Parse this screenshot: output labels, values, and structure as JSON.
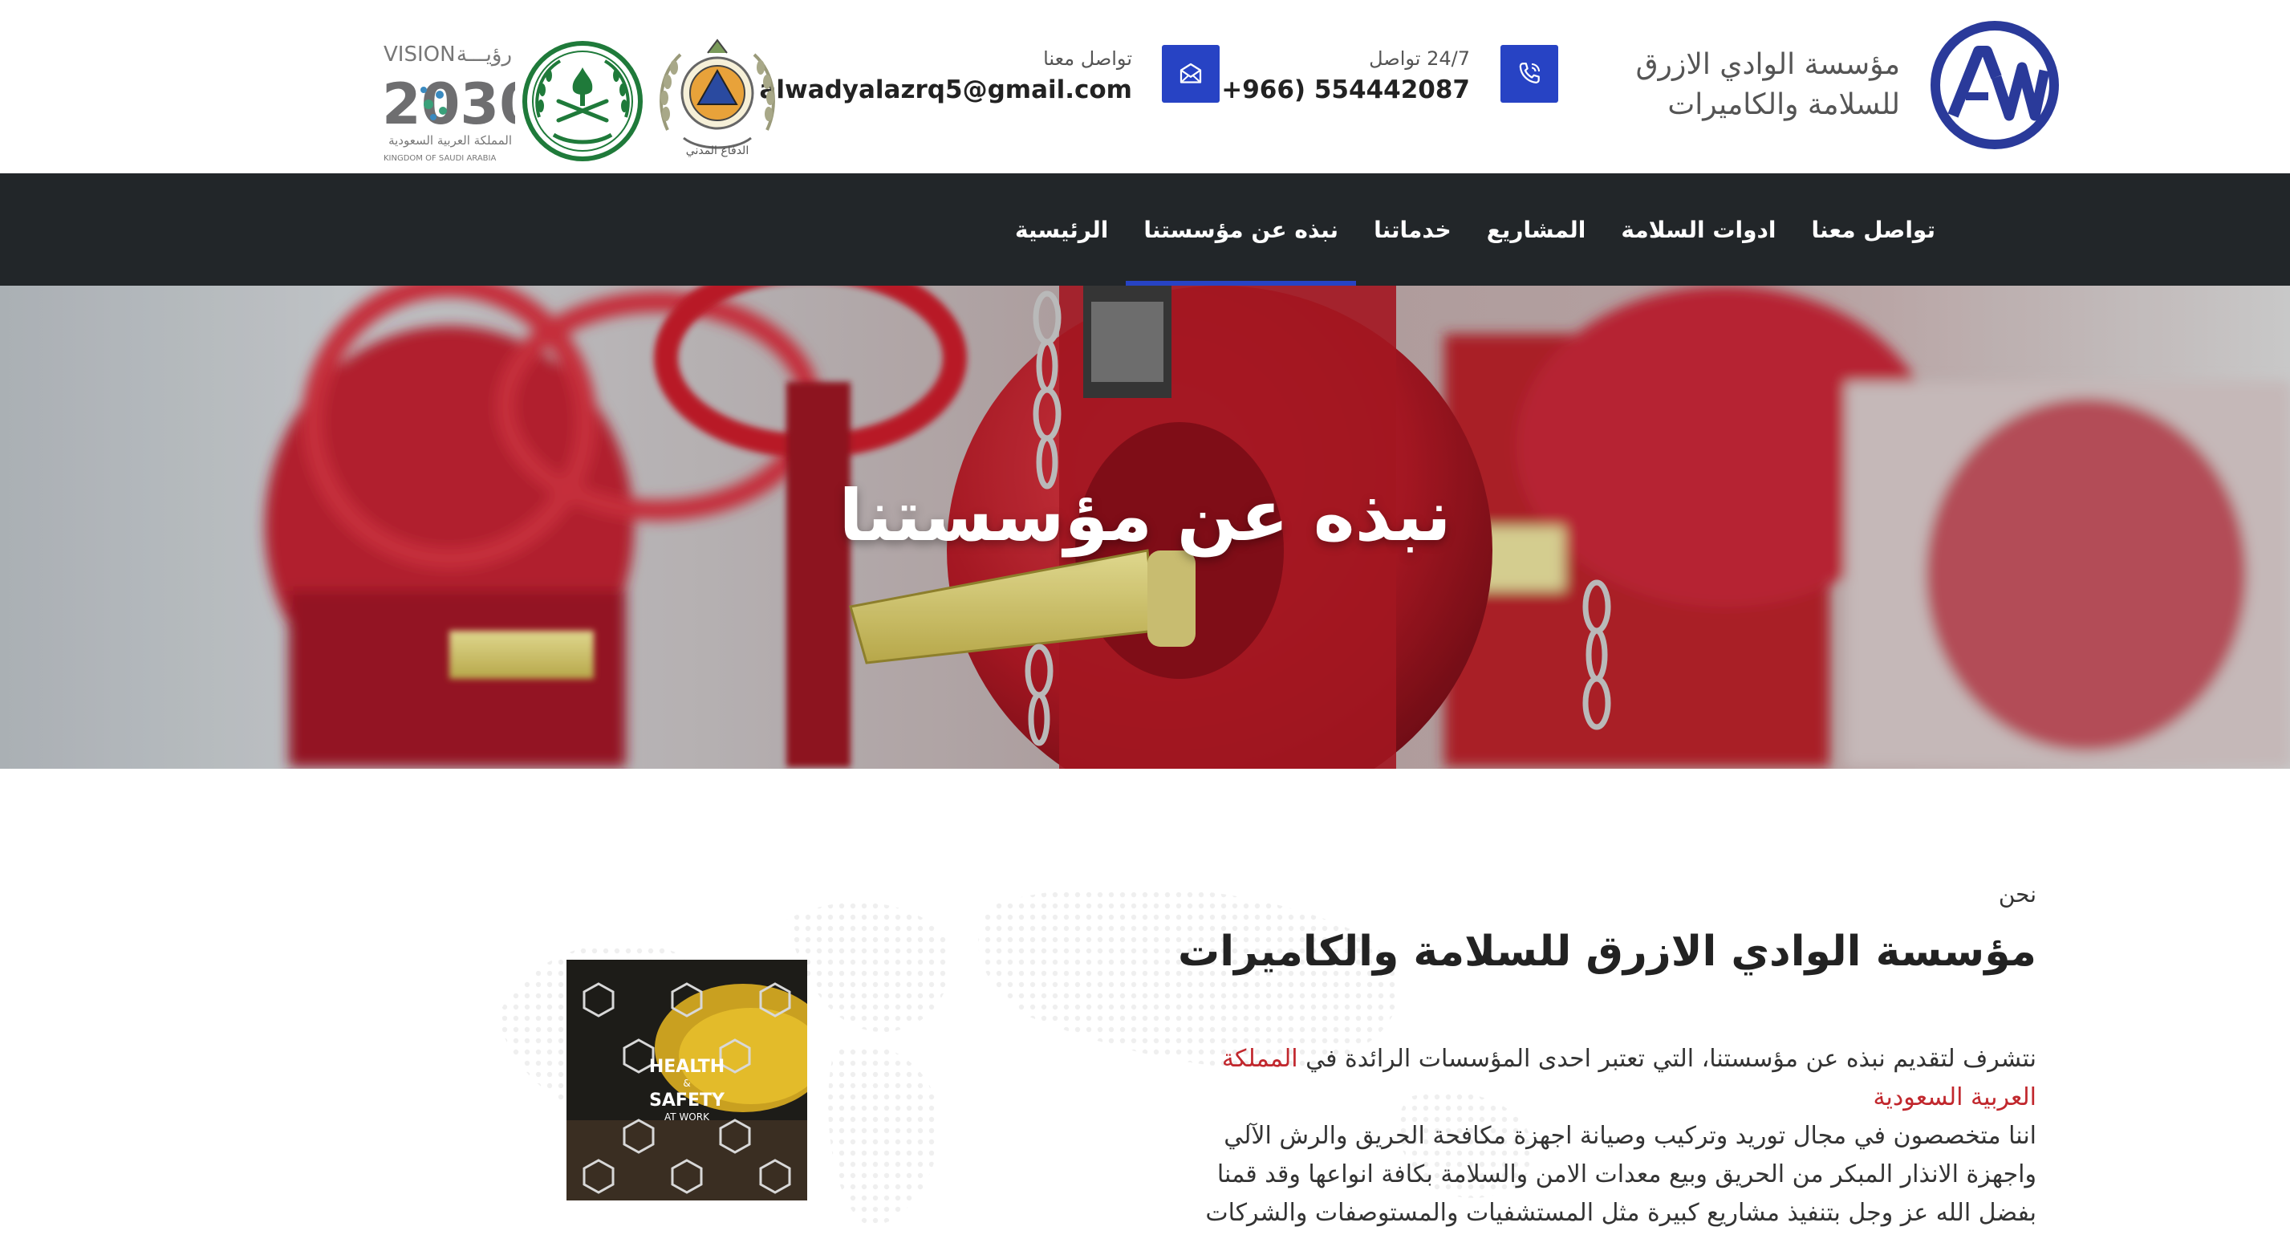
{
  "header": {
    "brand_line1": "مؤسسة الوادي الازرق",
    "brand_line2": "للسلامة والكاميرات",
    "phone_caption": "24/7 تواصل",
    "phone_number": "(+966) 554442087",
    "mail_caption": "تواصل معنا",
    "email": "alwadyalazrq5@gmail.com",
    "vision_arabic": "رؤيـــة",
    "vision_latin": "VISION",
    "vision_year": "2030",
    "vision_kingdom_ar": "المملكة العربية السعودية",
    "vision_kingdom_en": "KINGDOM OF SAUDI ARABIA",
    "civil_defense_text": "الدفاع المدني"
  },
  "nav": {
    "items": [
      {
        "label": "الرئيسية"
      },
      {
        "label": "نبذه عن مؤسستنا"
      },
      {
        "label": "خدماتنا"
      },
      {
        "label": "المشاريع"
      },
      {
        "label": "ادوات السلامة"
      },
      {
        "label": "تواصل معنا"
      }
    ],
    "active_index": 1
  },
  "hero": {
    "title": "نبذه عن مؤسستنا"
  },
  "about": {
    "kicker": "نحن",
    "title": "مؤسسة الوادي الازرق للسلامة والكاميرات",
    "p1_before": "نتشرف لتقديم نبذه عن مؤسستنا، التي تعتبر احدى المؤسسات الرائدة في ",
    "p1_highlight": "المملكة العربية السعودية",
    "p2": "اننا متخصصون في مجال توريد وتركيب وصيانة اجهزة مكافحة الحريق والرش الآلي واجهزة الانذار المبكر من الحريق وبيع معدات الامن والسلامة بكافة انواعها وقد قمنا بفضل الله عز وجل بتنفيذ مشاريع كبيرة مثل المستشفيات والمستوصفات والشركات",
    "image_text_line1": "HEALTH",
    "image_text_amp": "&",
    "image_text_line2": "SAFETY",
    "image_text_line3": "AT WORK"
  },
  "colors": {
    "accent": "#2743c4",
    "nav_bg": "#222629",
    "highlight": "#c1272d"
  }
}
